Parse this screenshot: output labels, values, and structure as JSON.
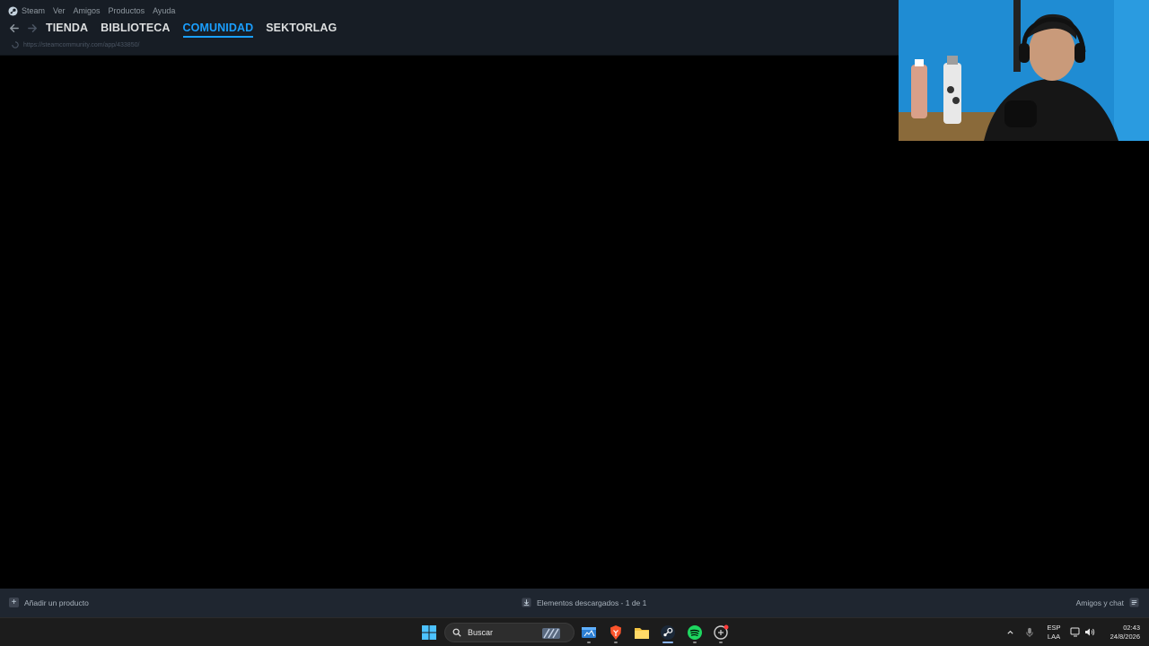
{
  "menubar": {
    "items": [
      "Steam",
      "Ver",
      "Amigos",
      "Productos",
      "Ayuda"
    ]
  },
  "navbar": {
    "tabs": [
      {
        "label": "TIENDA",
        "active": false
      },
      {
        "label": "BIBLIOTECA",
        "active": false
      },
      {
        "label": "COMUNIDAD",
        "active": true
      },
      {
        "label": "SEKTORLAG",
        "active": false
      }
    ],
    "url": "https://steamcommunity.com/app/433850/"
  },
  "statusbar": {
    "add_product": "Añadir un producto",
    "downloads": "Elementos descargados - 1 de 1",
    "friends": "Amigos y chat"
  },
  "taskbar": {
    "search_placeholder": "Buscar",
    "apps": [
      "windows-start",
      "file-explorer-widget",
      "brave-browser",
      "file-explorer",
      "steam",
      "spotify",
      "game-app"
    ],
    "lang_top": "ESP",
    "lang_bottom": "LAA",
    "time": "02:43",
    "date": "24/8/2026"
  },
  "colors": {
    "accent": "#1a9fff",
    "nav_bg": "#171d25",
    "status_bg": "#1f2630",
    "taskbar_bg": "#1c1c1c"
  }
}
